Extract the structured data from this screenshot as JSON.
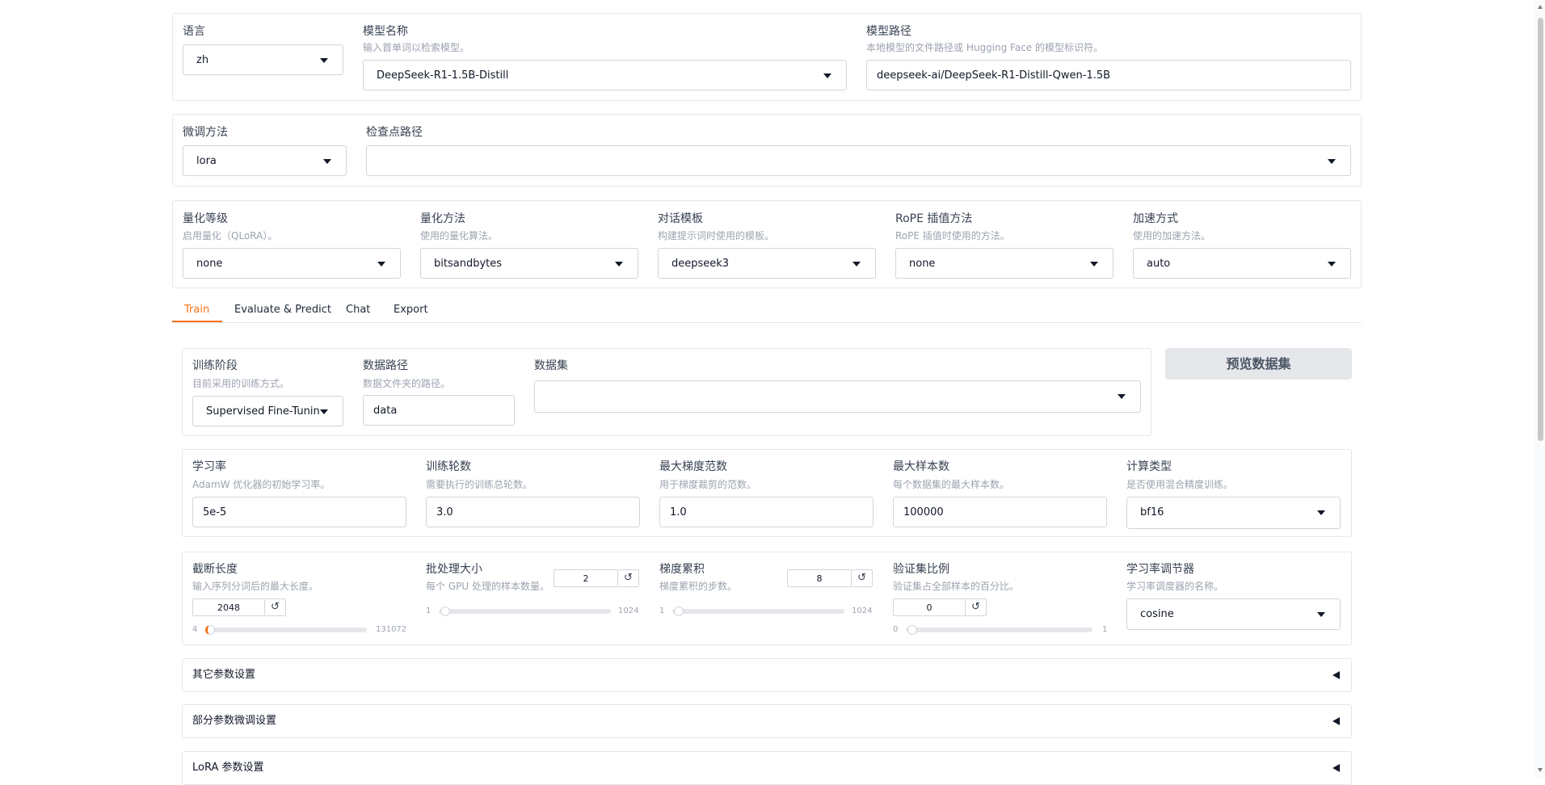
{
  "top": {
    "lang_label": "语言",
    "lang_value": "zh",
    "model_name_label": "模型名称",
    "model_name_info": "输入首单词以检索模型。",
    "model_name_value": "DeepSeek-R1-1.5B-Distill",
    "model_path_label": "模型路径",
    "model_path_info": "本地模型的文件路径或 Hugging Face 的模型标识符。",
    "model_path_value": "deepseek-ai/DeepSeek-R1-Distill-Qwen-1.5B"
  },
  "row2": {
    "finetune_label": "微调方法",
    "finetune_value": "lora",
    "checkpoint_label": "检查点路径",
    "checkpoint_value": ""
  },
  "row3": {
    "quant_bit_label": "量化等级",
    "quant_bit_info": "启用量化（QLoRA）。",
    "quant_bit_value": "none",
    "quant_method_label": "量化方法",
    "quant_method_info": "使用的量化算法。",
    "quant_method_value": "bitsandbytes",
    "template_label": "对话模板",
    "template_info": "构建提示词时使用的模板。",
    "template_value": "deepseek3",
    "rope_label": "RoPE 插值方法",
    "rope_info": "RoPE 插值时使用的方法。",
    "rope_value": "none",
    "booster_label": "加速方式",
    "booster_info": "使用的加速方法。",
    "booster_value": "auto"
  },
  "tabs": [
    "Train",
    "Evaluate & Predict",
    "Chat",
    "Export"
  ],
  "active_tab": "Train",
  "train": {
    "stage_label": "训练阶段",
    "stage_info": "目前采用的训练方式。",
    "stage_value": "Supervised Fine-Tuning",
    "datadir_label": "数据路径",
    "datadir_info": "数据文件夹的路径。",
    "datadir_value": "data",
    "dataset_label": "数据集",
    "dataset_value": "",
    "preview_button": "预览数据集",
    "lr_label": "学习率",
    "lr_info": "AdamW 优化器的初始学习率。",
    "lr_value": "5e-5",
    "epochs_label": "训练轮数",
    "epochs_info": "需要执行的训练总轮数。",
    "epochs_value": "3.0",
    "maxgrad_label": "最大梯度范数",
    "maxgrad_info": "用于梯度裁剪的范数。",
    "maxgrad_value": "1.0",
    "maxsamples_label": "最大样本数",
    "maxsamples_info": "每个数据集的最大样本数。",
    "maxsamples_value": "100000",
    "compute_label": "计算类型",
    "compute_info": "是否使用混合精度训练。",
    "compute_value": "bf16",
    "cutoff_label": "截断长度",
    "cutoff_info": "输入序列分词后的最大长度。",
    "cutoff_value": "2048",
    "cutoff_min": "4",
    "cutoff_max": "131072",
    "batch_label": "批处理大小",
    "batch_info": "每个 GPU 处理的样本数量。",
    "batch_value": "2",
    "batch_min": "1",
    "batch_max": "1024",
    "gradacc_label": "梯度累积",
    "gradacc_info": "梯度累积的步数。",
    "gradacc_value": "8",
    "gradacc_min": "1",
    "gradacc_max": "1024",
    "valsize_label": "验证集比例",
    "valsize_info": "验证集占全部样本的百分比。",
    "valsize_value": "0",
    "valsize_min": "0",
    "valsize_max": "1",
    "sched_label": "学习率调节器",
    "sched_info": "学习率调度器的名称。",
    "sched_value": "cosine"
  },
  "accordions": [
    "其它参数设置",
    "部分参数微调设置",
    "LoRA 参数设置"
  ],
  "reset_icon": "↺",
  "accent_color": "#f97316"
}
